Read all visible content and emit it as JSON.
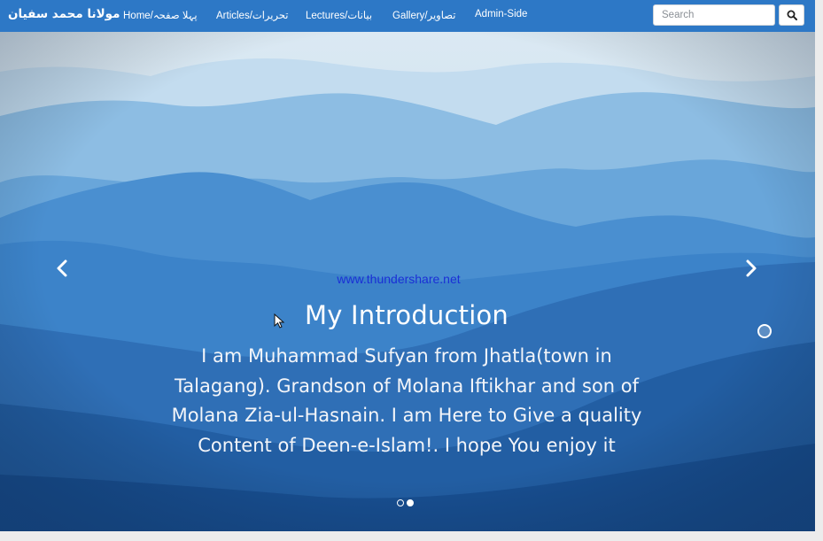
{
  "navbar": {
    "brand": "مولانا محمد سفیان",
    "items": [
      {
        "label": "Home/پہلا صفحہ",
        "key": "home"
      },
      {
        "label": "Articles/تحریرات",
        "key": "articles"
      },
      {
        "label": "Lectures/بیانات",
        "key": "lectures"
      },
      {
        "label": "Gallery/تصاویر",
        "key": "gallery"
      },
      {
        "label": "Admin-Side",
        "key": "admin"
      }
    ],
    "search": {
      "placeholder": "Search",
      "value": "",
      "button_icon": "search-icon"
    }
  },
  "carousel": {
    "watermark": "www.thundershare.net",
    "title": "My Introduction",
    "text": "I am Muhammad Sufyan from Jhatla(town in Talagang). Grandson of Molana Iftikhar and son of Molana Zia-ul-Hasnain. I am Here to Give a quality Content of Deen-e-Islam!. I hope You enjoy it",
    "prev_icon": "chevron-left-icon",
    "next_icon": "chevron-right-icon",
    "slide_count": 2,
    "active_slide": 2
  },
  "colors": {
    "navbar": "#2d78c6",
    "watermark": "#1a2fd6",
    "sky": "#dbe9f3",
    "mountains_dark": "#154d91"
  }
}
